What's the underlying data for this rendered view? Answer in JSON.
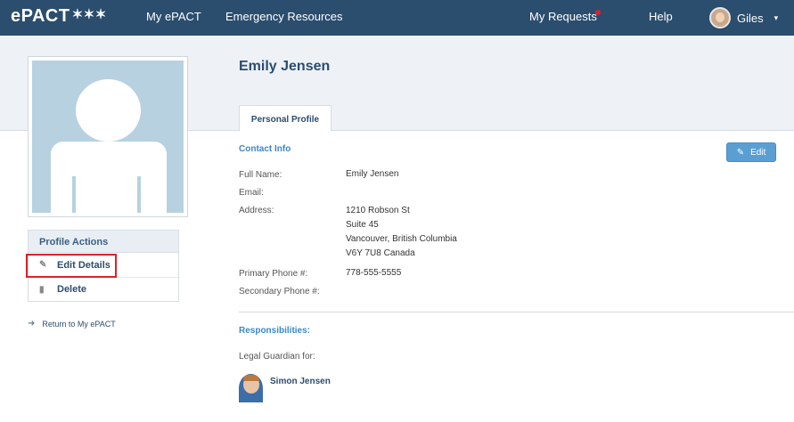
{
  "nav": {
    "logo": "ePACT",
    "logo_stars": "✶✶✶",
    "my_epact": "My ePACT",
    "emergency": "Emergency Resources",
    "my_requests": "My Requests",
    "help": "Help",
    "user_name": "Giles",
    "user_caret": "▾"
  },
  "profile": {
    "name": "Emily Jensen",
    "tab": "Personal Profile"
  },
  "actions": {
    "heading": "Profile Actions",
    "edit_icon": "✎",
    "edit": "Edit Details",
    "delete_icon": "▮",
    "delete": "Delete",
    "return_icon": "➜",
    "return": "Return to My ePACT"
  },
  "contact": {
    "heading": "Contact Info",
    "edit_label": "Edit",
    "edit_icon": "✎",
    "fields": {
      "full_name_label": "Full Name:",
      "full_name": "Emily Jensen",
      "email_label": "Email:",
      "address_label": "Address:",
      "address_line1": "1210 Robson St",
      "address_line2": "Suite 45",
      "address_line3": "Vancouver, British Columbia",
      "address_line4": "V6Y 7U8 Canada",
      "primary_label": "Primary Phone #:",
      "primary": "778-555-5555",
      "secondary_label": "Secondary Phone #:"
    }
  },
  "responsibilities": {
    "heading": "Responsibilities:",
    "legal_label": "Legal Guardian for:",
    "child_name": "Simon Jensen"
  },
  "colors": {
    "nav_bg": "#2b4d6e",
    "accent_blue": "#3a88c8",
    "edit_button": "#5b9fd2",
    "highlight": "#e0202a",
    "notification_dot": "#e0202a"
  }
}
